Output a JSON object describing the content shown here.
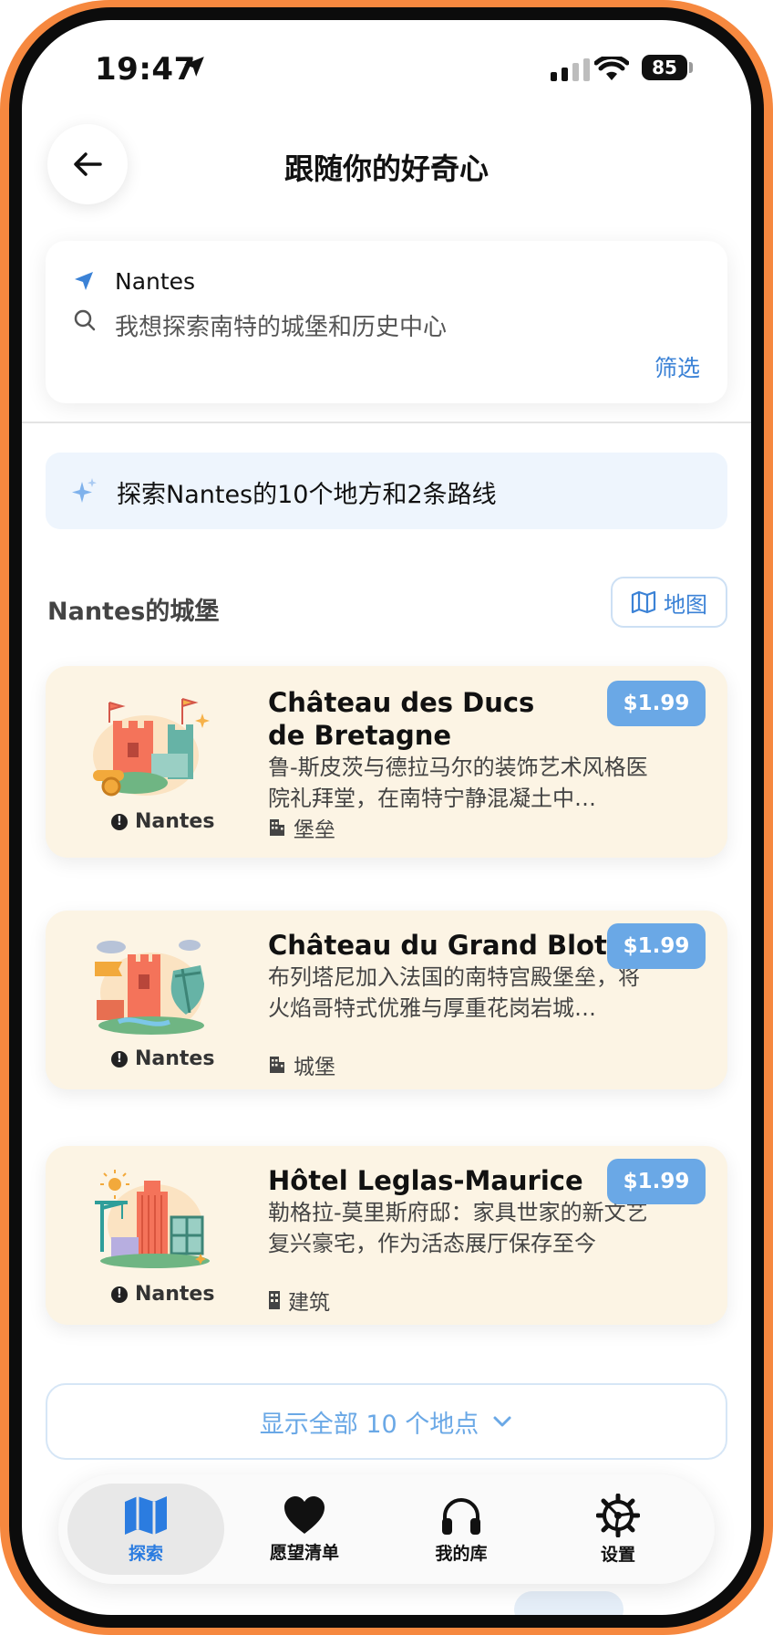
{
  "status_bar": {
    "time": "19:47",
    "battery": "85"
  },
  "header": {
    "title": "跟随你的好奇心"
  },
  "search": {
    "location": "Nantes",
    "query": "我想探索南特的城堡和历史中心",
    "filter_label": "筛选"
  },
  "summary": {
    "text": "探索Nantes的10个地方和2条路线"
  },
  "section": {
    "title": "Nantes的城堡",
    "map_label": "地图"
  },
  "cards": [
    {
      "title": "Château des Ducs de Bretagne",
      "description": "鲁-斯皮茨与德拉马尔的装饰艺术风格医院礼拜堂，在南特宁静混凝土中…",
      "city": "Nantes",
      "type": "堡垒",
      "price": "$1.99"
    },
    {
      "title": "Château du Grand Blottereau",
      "description": "布列塔尼加入法国的南特宫殿堡垒，将火焰哥特式优雅与厚重花岗岩城…",
      "city": "Nantes",
      "type": "城堡",
      "price": "$1.99"
    },
    {
      "title": "Hôtel Leglas-Maurice",
      "description": "勒格拉-莫里斯府邸：家具世家的新文艺复兴豪宅，作为活态展厅保存至今",
      "city": "Nantes",
      "type": "建筑",
      "price": "$1.99"
    }
  ],
  "show_all": {
    "label": "显示全部 10 个地点"
  },
  "tabs": [
    {
      "label": "探索",
      "icon": "map-icon",
      "active": true
    },
    {
      "label": "愿望清单",
      "icon": "heart-icon",
      "active": false
    },
    {
      "label": "我的库",
      "icon": "headphones-icon",
      "active": false
    },
    {
      "label": "设置",
      "icon": "gear-icon",
      "active": false
    }
  ],
  "colors": {
    "accent": "#3B82D6",
    "card_bg": "#FCF4E4",
    "price_bg": "#6AA8E6",
    "frame": "#F6883F"
  }
}
